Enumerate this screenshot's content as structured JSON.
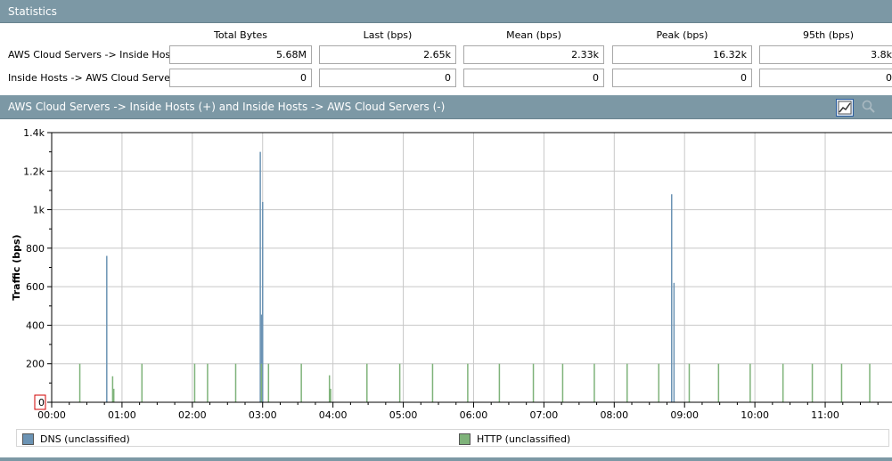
{
  "stats": {
    "title": "Statistics",
    "columns": [
      "Total Bytes",
      "Last (bps)",
      "Mean (bps)",
      "Peak (bps)",
      "95th (bps)"
    ],
    "rows": [
      {
        "label": "AWS Cloud Servers -> Inside Hosts:",
        "values": [
          "5.68M",
          "2.65k",
          "2.33k",
          "16.32k",
          "3.8k"
        ]
      },
      {
        "label": "Inside Hosts -> AWS Cloud Servers:",
        "values": [
          "0",
          "0",
          "0",
          "0",
          "0"
        ]
      }
    ]
  },
  "chart_panel": {
    "title": "AWS Cloud Servers -> Inside Hosts (+) and Inside Hosts -> AWS Cloud Servers (-)",
    "chart_icon": "line-chart-icon",
    "zoom_icon": "zoom-icon"
  },
  "chart_data": {
    "type": "bar",
    "ylabel": "Traffic (bps)",
    "xlabel": "",
    "ylim": [
      0,
      1400
    ],
    "xlim_hours": [
      0,
      11.95
    ],
    "y_ticks": [
      "0",
      "200",
      "400",
      "600",
      "800",
      "1k",
      "1.2k",
      "1.4k"
    ],
    "y_tick_values": [
      0,
      200,
      400,
      600,
      800,
      1000,
      1200,
      1400
    ],
    "x_ticks": [
      "00:00",
      "01:00",
      "02:00",
      "03:00",
      "04:00",
      "05:00",
      "06:00",
      "07:00",
      "08:00",
      "09:00",
      "10:00",
      "11:00"
    ],
    "grid": true,
    "legend_position": "bottom",
    "series": [
      {
        "name": "DNS (unclassified)",
        "color": "#6b93b4",
        "points": [
          {
            "x": "00:47",
            "y": 760
          },
          {
            "x": "02:58",
            "y": 1300
          },
          {
            "x": "02:59",
            "y": 455
          },
          {
            "x": "03:00",
            "y": 1040
          },
          {
            "x": "08:49",
            "y": 1080
          },
          {
            "x": "08:51",
            "y": 620
          }
        ]
      },
      {
        "name": "HTTP (unclassified)",
        "color": "#7fb37a",
        "points": [
          {
            "x": "00:24",
            "y": 200
          },
          {
            "x": "00:52",
            "y": 135
          },
          {
            "x": "00:53",
            "y": 70
          },
          {
            "x": "01:17",
            "y": 200
          },
          {
            "x": "02:02",
            "y": 200
          },
          {
            "x": "02:13",
            "y": 200
          },
          {
            "x": "02:37",
            "y": 200
          },
          {
            "x": "02:59",
            "y": 200
          },
          {
            "x": "03:05",
            "y": 200
          },
          {
            "x": "03:33",
            "y": 200
          },
          {
            "x": "03:57",
            "y": 140
          },
          {
            "x": "03:58",
            "y": 70
          },
          {
            "x": "04:29",
            "y": 200
          },
          {
            "x": "04:57",
            "y": 200
          },
          {
            "x": "05:25",
            "y": 200
          },
          {
            "x": "05:55",
            "y": 200
          },
          {
            "x": "06:22",
            "y": 200
          },
          {
            "x": "06:51",
            "y": 200
          },
          {
            "x": "07:16",
            "y": 200
          },
          {
            "x": "07:43",
            "y": 200
          },
          {
            "x": "08:11",
            "y": 200
          },
          {
            "x": "08:38",
            "y": 200
          },
          {
            "x": "09:04",
            "y": 200
          },
          {
            "x": "09:29",
            "y": 200
          },
          {
            "x": "09:56",
            "y": 200
          },
          {
            "x": "10:24",
            "y": 200
          },
          {
            "x": "10:49",
            "y": 200
          },
          {
            "x": "11:14",
            "y": 200
          },
          {
            "x": "11:38",
            "y": 200
          }
        ]
      }
    ]
  }
}
